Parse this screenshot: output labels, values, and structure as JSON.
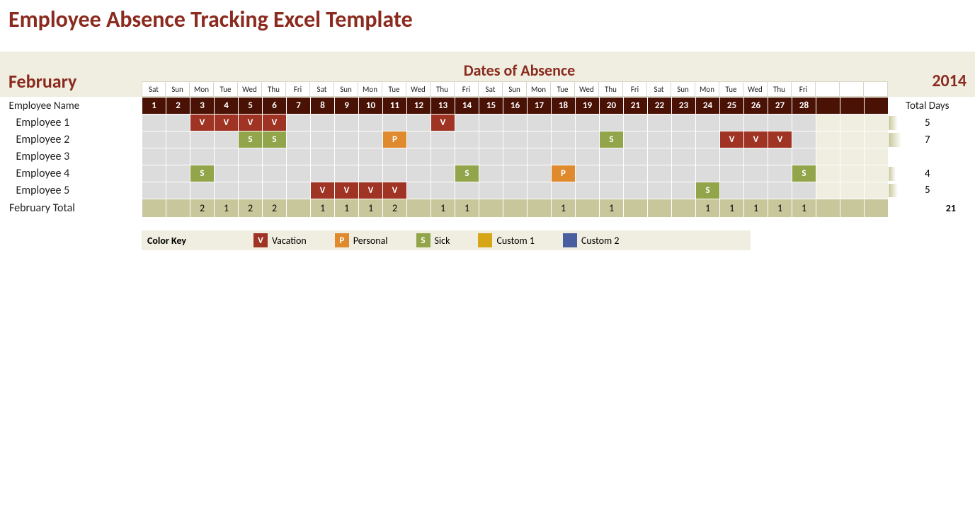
{
  "title": "Employee Absence Tracking Excel Template",
  "month": "February",
  "dates_heading": "Dates of Absence",
  "year": "2014",
  "total_days_label": "Total Days",
  "employee_name_label": "Employee Name",
  "days_of_week": [
    "Sat",
    "Sun",
    "Mon",
    "Tue",
    "Wed",
    "Thu",
    "Fri",
    "Sat",
    "Sun",
    "Mon",
    "Tue",
    "Wed",
    "Thu",
    "Fri",
    "Sat",
    "Sun",
    "Mon",
    "Tue",
    "Wed",
    "Thu",
    "Fri",
    "Sat",
    "Sun",
    "Mon",
    "Tue",
    "Wed",
    "Thu",
    "Fri"
  ],
  "day_numbers": [
    "1",
    "2",
    "3",
    "4",
    "5",
    "6",
    "7",
    "8",
    "9",
    "10",
    "11",
    "12",
    "13",
    "14",
    "15",
    "16",
    "17",
    "18",
    "19",
    "20",
    "21",
    "22",
    "23",
    "24",
    "25",
    "26",
    "27",
    "28"
  ],
  "extra_cols": 3,
  "employees": [
    {
      "name": "Employee 1",
      "total": "5",
      "codes": {
        "3": "V",
        "4": "V",
        "5": "V",
        "6": "V",
        "13": "V"
      }
    },
    {
      "name": "Employee 2",
      "total": "7",
      "codes": {
        "5": "S",
        "6": "S",
        "11": "P",
        "20": "S",
        "25": "V",
        "26": "V",
        "27": "V"
      }
    },
    {
      "name": "Employee 3",
      "total": "",
      "codes": {}
    },
    {
      "name": "Employee 4",
      "total": "4",
      "codes": {
        "3": "S",
        "14": "S",
        "18": "P",
        "28": "S"
      }
    },
    {
      "name": "Employee 5",
      "total": "5",
      "codes": {
        "8": "V",
        "9": "V",
        "10": "V",
        "11": "V",
        "24": "S"
      }
    }
  ],
  "month_total": {
    "label": "February Total",
    "per_day": {
      "3": "2",
      "4": "1",
      "5": "2",
      "6": "2",
      "8": "1",
      "9": "1",
      "10": "1",
      "11": "2",
      "13": "1",
      "14": "1",
      "18": "1",
      "20": "1",
      "24": "1",
      "25": "1",
      "26": "1",
      "27": "1",
      "28": "1"
    },
    "grand": "21"
  },
  "legend": {
    "title": "Color Key",
    "items": [
      {
        "code": "V",
        "label": "Vacation"
      },
      {
        "code": "P",
        "label": "Personal"
      },
      {
        "code": "S",
        "label": "Sick"
      },
      {
        "code": "C1",
        "label": "Custom 1"
      },
      {
        "code": "C2",
        "label": "Custom 2"
      }
    ]
  }
}
